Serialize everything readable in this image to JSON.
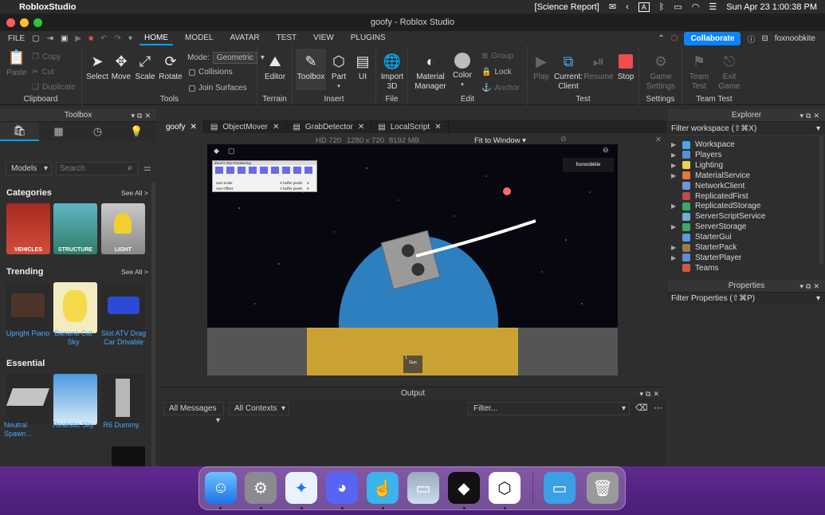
{
  "menubar": {
    "app_name": "RobloxStudio",
    "report": "[Science Report]",
    "clock": "Sun Apr 23  1:00:38 PM",
    "a_label": "A"
  },
  "window": {
    "title": "goofy - Roblox Studio"
  },
  "menus": {
    "file": "FILE",
    "tabs": [
      "HOME",
      "MODEL",
      "AVATAR",
      "TEST",
      "VIEW",
      "PLUGINS"
    ],
    "collaborate": "Collaborate",
    "username": "foxnoobkite"
  },
  "ribbon": {
    "clipboard": {
      "label": "Clipboard",
      "paste": "Paste",
      "copy": "Copy",
      "cut": "Cut",
      "duplicate": "Duplicate"
    },
    "tools": {
      "label": "Tools",
      "select": "Select",
      "move": "Move",
      "scale": "Scale",
      "rotate": "Rotate",
      "mode_label": "Mode:",
      "mode_value": "Geometric",
      "collisions": "Collisions",
      "join": "Join Surfaces"
    },
    "terrain": {
      "label": "Terrain",
      "editor": "Editor"
    },
    "insert": {
      "label": "Insert",
      "toolbox": "Toolbox",
      "part": "Part",
      "ui": "UI"
    },
    "file": {
      "label": "File",
      "import": "Import\n3D"
    },
    "edit": {
      "label": "Edit",
      "material": "Material\nManager",
      "color": "Color",
      "group": "Group",
      "lock": "Lock",
      "anchor": "Anchor"
    },
    "test": {
      "label": "Test",
      "play": "Play",
      "current": "Current:\nClient",
      "resume": "Resume",
      "stop": "Stop"
    },
    "settings": {
      "label": "Settings",
      "game_settings": "Game\nSettings"
    },
    "team_test": {
      "label": "Team Test",
      "team_test": "Team\nTest",
      "exit_game": "Exit\nGame"
    }
  },
  "toolbox": {
    "title": "Toolbox",
    "models": "Models",
    "search_placeholder": "Search",
    "categories_title": "Categories",
    "see_all": "See All >",
    "categories": [
      {
        "label": "VEHICLES",
        "color": "#b8342b"
      },
      {
        "label": "STRUCTURE",
        "color": "#3a8f95"
      },
      {
        "label": "LIGHT",
        "color": "#9a9a9a"
      }
    ],
    "trending_title": "Trending",
    "trending": [
      "Upright Piano",
      "Banana Cat\nSky",
      "Slot ATV Drag\nCar Drivable"
    ],
    "essential_title": "Essential",
    "essential": [
      "Neutral\nSpawn…",
      "Realistic Sky",
      "R6 Dummy"
    ]
  },
  "doc_tabs": [
    "goofy",
    "ObjectMover",
    "GrabDetector",
    "LocalScript"
  ],
  "viewport_info": {
    "hd": "HD 720",
    "res": "1280 x 720",
    "mem": "8192 MB",
    "fit": "Fit to Window"
  },
  "game_ui": {
    "username": "foxnoobkite",
    "gui_title": "Zeon's GUI Positioning",
    "use_scale": "Use Scale",
    "use_offset": "Use Offset",
    "xbuffer": "X buffer pixels",
    "ybuffer": "Y buffer pixels",
    "zero": "0",
    "gun": "Gun",
    "one": "1"
  },
  "output": {
    "title": "Output",
    "all_messages": "All Messages",
    "all_contexts": "All Contexts",
    "filter": "Filter..."
  },
  "explorer": {
    "title": "Explorer",
    "filter": "Filter workspace (⇧⌘X)",
    "items": [
      {
        "name": "Workspace",
        "arrow": true,
        "color": "#4aa8e8"
      },
      {
        "name": "Players",
        "arrow": true,
        "color": "#5a8fd8"
      },
      {
        "name": "Lighting",
        "arrow": true,
        "color": "#f2d04a"
      },
      {
        "name": "MaterialService",
        "arrow": true,
        "color": "#e07a3a"
      },
      {
        "name": "NetworkClient",
        "arrow": false,
        "color": "#6a9ad8"
      },
      {
        "name": "ReplicatedFirst",
        "arrow": false,
        "color": "#c04a4a"
      },
      {
        "name": "ReplicatedStorage",
        "arrow": true,
        "color": "#3aa86a"
      },
      {
        "name": "ServerScriptService",
        "arrow": false,
        "color": "#6ab0d8"
      },
      {
        "name": "ServerStorage",
        "arrow": true,
        "color": "#3aa86a"
      },
      {
        "name": "StarterGui",
        "arrow": false,
        "color": "#5a9ae0"
      },
      {
        "name": "StarterPack",
        "arrow": true,
        "color": "#a07a4a"
      },
      {
        "name": "StarterPlayer",
        "arrow": true,
        "color": "#5a8fd8"
      },
      {
        "name": "Teams",
        "arrow": false,
        "color": "#d05a3a"
      }
    ]
  },
  "properties": {
    "title": "Properties",
    "filter": "Filter Properties (⇧⌘P)"
  }
}
